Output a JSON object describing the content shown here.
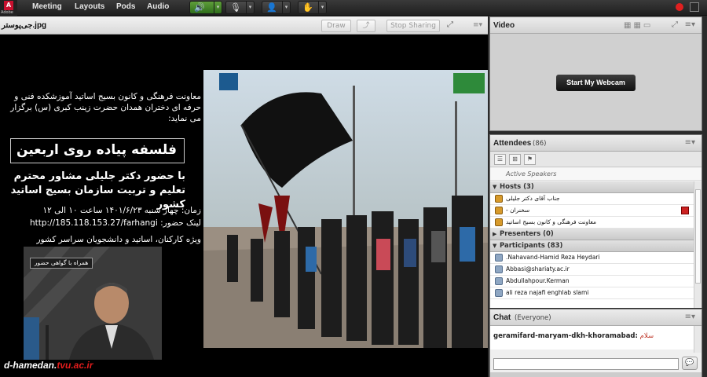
{
  "menubar": {
    "logo_text": "Adobe",
    "items": [
      "Meeting",
      "Layouts",
      "Pods",
      "Audio"
    ],
    "icons": {
      "speaker": "speaker-icon",
      "mic": "microphone-icon",
      "camera": "webcam-icon",
      "status": "raise-hand-icon"
    }
  },
  "share": {
    "title": "جی‌پوستر.jpg",
    "buttons": {
      "draw": "Draw",
      "stop": "Stop Sharing"
    }
  },
  "slide": {
    "announcement": "معاونت فرهنگی و کانون بسیج اساتید آموزشکده فنی و حرفه ای دختران همدان حضرت زینب کبری (س) برگزار می نماید:",
    "event_title": "فلسفه پیاده روی اربعین",
    "speaker": "با حضور دکتر جلیلی مشاور محترم تعلیم و تربیت سازمان بسیج اساتید کشور",
    "time": "زمان: چهار شنبه ۱۴۰۱/۶/۲۳ ساعت ۱۰ الی ۱۲",
    "link": "لینک حضور: http://185.118.153.27/farhangi",
    "audience": "ویژه کارکنان، اساتید و دانشجویان سراسر کشور",
    "photo_tag": "همراه با گواهی حضور",
    "footer_prefix": "d-hamedan.",
    "footer_red": "tvu.ac.ir"
  },
  "video": {
    "title": "Video",
    "webcam_button": "Start My Webcam"
  },
  "attendees": {
    "title": "Attendees",
    "count": "(86)",
    "active_speakers": "Active Speakers",
    "groups": [
      {
        "label": "Hosts (3)",
        "role": "host",
        "rows": [
          "جناب آقای دکتر جلیلی",
          "- سخنران",
          "معاونت فرهنگی و کانون بسیج اساتید"
        ]
      },
      {
        "label": "Presenters (0)",
        "role": "none",
        "rows": []
      },
      {
        "label": "Participants (83)",
        "role": "part",
        "rows": [
          ".Nahavand-Hamid Reza Heydari",
          "Abbasi@shariaty.ac.ir",
          "Abdullahpour.Kerman",
          "ali reza najafi enghlab slami"
        ]
      }
    ]
  },
  "chat": {
    "title": "Chat",
    "scope": "(Everyone)",
    "sender": "geramifard-maryam-dkh-khoramabad:",
    "message": "سلام",
    "input_placeholder": ""
  },
  "colors": {
    "speaker_active": "#3f8a2a",
    "record": "#e02020",
    "footer_red": "#e41d1d",
    "chat_msg": "#c0392b"
  }
}
